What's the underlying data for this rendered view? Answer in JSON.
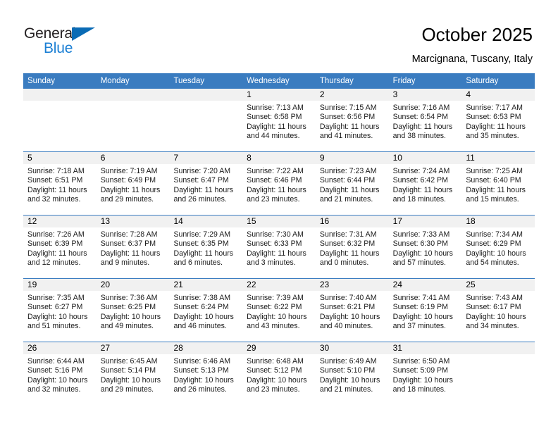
{
  "brand": {
    "name_top": "General",
    "name_bottom": "Blue",
    "color_dark": "#231f20",
    "color_blue": "#1b7fd4",
    "triangle_color": "#0a6bb5"
  },
  "header": {
    "title": "October 2025",
    "subtitle": "Marcignana, Tuscany, Italy"
  },
  "theme": {
    "header_bar": "#3a7cc0",
    "daynum_bar": "#f1f1f1",
    "cell_bg": "#ffffff",
    "text": "#000000"
  },
  "weekdays": [
    "Sunday",
    "Monday",
    "Tuesday",
    "Wednesday",
    "Thursday",
    "Friday",
    "Saturday"
  ],
  "weeks": [
    [
      {
        "day": "",
        "empty": true
      },
      {
        "day": "",
        "empty": true
      },
      {
        "day": "",
        "empty": true
      },
      {
        "day": "1",
        "sunrise": "Sunrise: 7:13 AM",
        "sunset": "Sunset: 6:58 PM",
        "daylight1": "Daylight: 11 hours",
        "daylight2": "and 44 minutes."
      },
      {
        "day": "2",
        "sunrise": "Sunrise: 7:15 AM",
        "sunset": "Sunset: 6:56 PM",
        "daylight1": "Daylight: 11 hours",
        "daylight2": "and 41 minutes."
      },
      {
        "day": "3",
        "sunrise": "Sunrise: 7:16 AM",
        "sunset": "Sunset: 6:54 PM",
        "daylight1": "Daylight: 11 hours",
        "daylight2": "and 38 minutes."
      },
      {
        "day": "4",
        "sunrise": "Sunrise: 7:17 AM",
        "sunset": "Sunset: 6:53 PM",
        "daylight1": "Daylight: 11 hours",
        "daylight2": "and 35 minutes."
      }
    ],
    [
      {
        "day": "5",
        "sunrise": "Sunrise: 7:18 AM",
        "sunset": "Sunset: 6:51 PM",
        "daylight1": "Daylight: 11 hours",
        "daylight2": "and 32 minutes."
      },
      {
        "day": "6",
        "sunrise": "Sunrise: 7:19 AM",
        "sunset": "Sunset: 6:49 PM",
        "daylight1": "Daylight: 11 hours",
        "daylight2": "and 29 minutes."
      },
      {
        "day": "7",
        "sunrise": "Sunrise: 7:20 AM",
        "sunset": "Sunset: 6:47 PM",
        "daylight1": "Daylight: 11 hours",
        "daylight2": "and 26 minutes."
      },
      {
        "day": "8",
        "sunrise": "Sunrise: 7:22 AM",
        "sunset": "Sunset: 6:46 PM",
        "daylight1": "Daylight: 11 hours",
        "daylight2": "and 23 minutes."
      },
      {
        "day": "9",
        "sunrise": "Sunrise: 7:23 AM",
        "sunset": "Sunset: 6:44 PM",
        "daylight1": "Daylight: 11 hours",
        "daylight2": "and 21 minutes."
      },
      {
        "day": "10",
        "sunrise": "Sunrise: 7:24 AM",
        "sunset": "Sunset: 6:42 PM",
        "daylight1": "Daylight: 11 hours",
        "daylight2": "and 18 minutes."
      },
      {
        "day": "11",
        "sunrise": "Sunrise: 7:25 AM",
        "sunset": "Sunset: 6:40 PM",
        "daylight1": "Daylight: 11 hours",
        "daylight2": "and 15 minutes."
      }
    ],
    [
      {
        "day": "12",
        "sunrise": "Sunrise: 7:26 AM",
        "sunset": "Sunset: 6:39 PM",
        "daylight1": "Daylight: 11 hours",
        "daylight2": "and 12 minutes."
      },
      {
        "day": "13",
        "sunrise": "Sunrise: 7:28 AM",
        "sunset": "Sunset: 6:37 PM",
        "daylight1": "Daylight: 11 hours",
        "daylight2": "and 9 minutes."
      },
      {
        "day": "14",
        "sunrise": "Sunrise: 7:29 AM",
        "sunset": "Sunset: 6:35 PM",
        "daylight1": "Daylight: 11 hours",
        "daylight2": "and 6 minutes."
      },
      {
        "day": "15",
        "sunrise": "Sunrise: 7:30 AM",
        "sunset": "Sunset: 6:33 PM",
        "daylight1": "Daylight: 11 hours",
        "daylight2": "and 3 minutes."
      },
      {
        "day": "16",
        "sunrise": "Sunrise: 7:31 AM",
        "sunset": "Sunset: 6:32 PM",
        "daylight1": "Daylight: 11 hours",
        "daylight2": "and 0 minutes."
      },
      {
        "day": "17",
        "sunrise": "Sunrise: 7:33 AM",
        "sunset": "Sunset: 6:30 PM",
        "daylight1": "Daylight: 10 hours",
        "daylight2": "and 57 minutes."
      },
      {
        "day": "18",
        "sunrise": "Sunrise: 7:34 AM",
        "sunset": "Sunset: 6:29 PM",
        "daylight1": "Daylight: 10 hours",
        "daylight2": "and 54 minutes."
      }
    ],
    [
      {
        "day": "19",
        "sunrise": "Sunrise: 7:35 AM",
        "sunset": "Sunset: 6:27 PM",
        "daylight1": "Daylight: 10 hours",
        "daylight2": "and 51 minutes."
      },
      {
        "day": "20",
        "sunrise": "Sunrise: 7:36 AM",
        "sunset": "Sunset: 6:25 PM",
        "daylight1": "Daylight: 10 hours",
        "daylight2": "and 49 minutes."
      },
      {
        "day": "21",
        "sunrise": "Sunrise: 7:38 AM",
        "sunset": "Sunset: 6:24 PM",
        "daylight1": "Daylight: 10 hours",
        "daylight2": "and 46 minutes."
      },
      {
        "day": "22",
        "sunrise": "Sunrise: 7:39 AM",
        "sunset": "Sunset: 6:22 PM",
        "daylight1": "Daylight: 10 hours",
        "daylight2": "and 43 minutes."
      },
      {
        "day": "23",
        "sunrise": "Sunrise: 7:40 AM",
        "sunset": "Sunset: 6:21 PM",
        "daylight1": "Daylight: 10 hours",
        "daylight2": "and 40 minutes."
      },
      {
        "day": "24",
        "sunrise": "Sunrise: 7:41 AM",
        "sunset": "Sunset: 6:19 PM",
        "daylight1": "Daylight: 10 hours",
        "daylight2": "and 37 minutes."
      },
      {
        "day": "25",
        "sunrise": "Sunrise: 7:43 AM",
        "sunset": "Sunset: 6:17 PM",
        "daylight1": "Daylight: 10 hours",
        "daylight2": "and 34 minutes."
      }
    ],
    [
      {
        "day": "26",
        "sunrise": "Sunrise: 6:44 AM",
        "sunset": "Sunset: 5:16 PM",
        "daylight1": "Daylight: 10 hours",
        "daylight2": "and 32 minutes."
      },
      {
        "day": "27",
        "sunrise": "Sunrise: 6:45 AM",
        "sunset": "Sunset: 5:14 PM",
        "daylight1": "Daylight: 10 hours",
        "daylight2": "and 29 minutes."
      },
      {
        "day": "28",
        "sunrise": "Sunrise: 6:46 AM",
        "sunset": "Sunset: 5:13 PM",
        "daylight1": "Daylight: 10 hours",
        "daylight2": "and 26 minutes."
      },
      {
        "day": "29",
        "sunrise": "Sunrise: 6:48 AM",
        "sunset": "Sunset: 5:12 PM",
        "daylight1": "Daylight: 10 hours",
        "daylight2": "and 23 minutes."
      },
      {
        "day": "30",
        "sunrise": "Sunrise: 6:49 AM",
        "sunset": "Sunset: 5:10 PM",
        "daylight1": "Daylight: 10 hours",
        "daylight2": "and 21 minutes."
      },
      {
        "day": "31",
        "sunrise": "Sunrise: 6:50 AM",
        "sunset": "Sunset: 5:09 PM",
        "daylight1": "Daylight: 10 hours",
        "daylight2": "and 18 minutes."
      },
      {
        "day": "",
        "empty": true
      }
    ]
  ]
}
